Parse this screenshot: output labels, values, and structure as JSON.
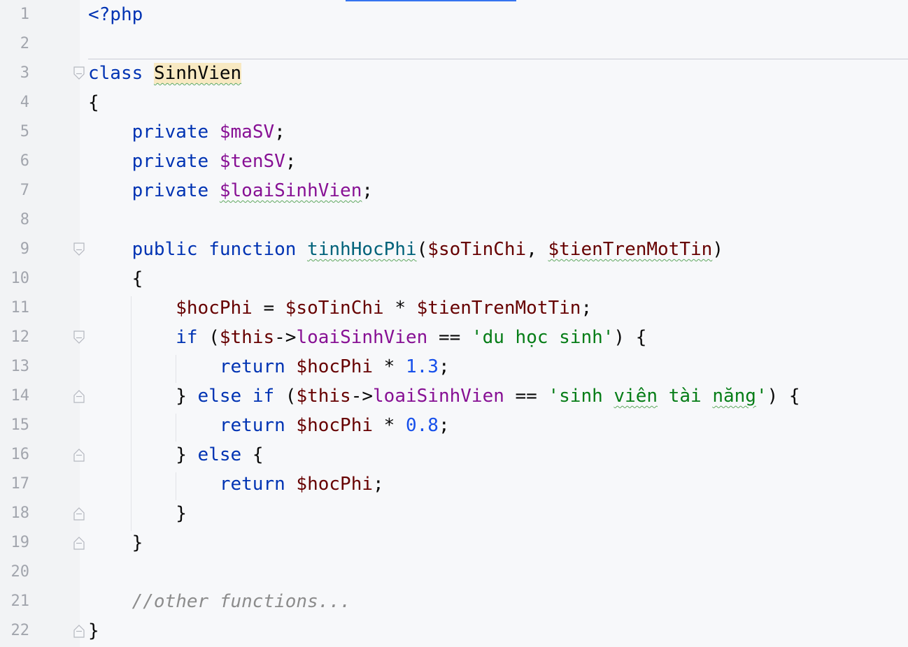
{
  "editor": {
    "language": "php",
    "lines": [
      {
        "num": "1",
        "tokens": [
          {
            "t": "<?php",
            "c": "kw"
          }
        ]
      },
      {
        "num": "2",
        "tokens": []
      },
      {
        "num": "3",
        "tokens": [
          {
            "t": "class",
            "c": "kw"
          },
          {
            "t": " ",
            "c": "punc"
          },
          {
            "t": "SinhVien",
            "c": "punc hl wavy"
          }
        ]
      },
      {
        "num": "4",
        "tokens": [
          {
            "t": "{",
            "c": "punc"
          }
        ]
      },
      {
        "num": "5",
        "tokens": [
          {
            "t": "    ",
            "c": "punc"
          },
          {
            "t": "private",
            "c": "kw"
          },
          {
            "t": " ",
            "c": "punc"
          },
          {
            "t": "$maSV",
            "c": "field"
          },
          {
            "t": ";",
            "c": "punc"
          }
        ]
      },
      {
        "num": "6",
        "tokens": [
          {
            "t": "    ",
            "c": "punc"
          },
          {
            "t": "private",
            "c": "kw"
          },
          {
            "t": " ",
            "c": "punc"
          },
          {
            "t": "$tenSV",
            "c": "field"
          },
          {
            "t": ";",
            "c": "punc"
          }
        ]
      },
      {
        "num": "7",
        "tokens": [
          {
            "t": "    ",
            "c": "punc"
          },
          {
            "t": "private",
            "c": "kw"
          },
          {
            "t": " ",
            "c": "punc"
          },
          {
            "t": "$loaiSinhVien",
            "c": "field wavy"
          },
          {
            "t": ";",
            "c": "punc"
          }
        ]
      },
      {
        "num": "8",
        "tokens": []
      },
      {
        "num": "9",
        "tokens": [
          {
            "t": "    ",
            "c": "punc"
          },
          {
            "t": "public",
            "c": "kw"
          },
          {
            "t": " ",
            "c": "punc"
          },
          {
            "t": "function",
            "c": "kw"
          },
          {
            "t": " ",
            "c": "punc"
          },
          {
            "t": "tinhHocPhi",
            "c": "fn wavy"
          },
          {
            "t": "(",
            "c": "punc"
          },
          {
            "t": "$soTinChi",
            "c": "var"
          },
          {
            "t": ", ",
            "c": "punc"
          },
          {
            "t": "$tienTrenMotTin",
            "c": "var wavy"
          },
          {
            "t": ")",
            "c": "punc"
          }
        ]
      },
      {
        "num": "10",
        "tokens": [
          {
            "t": "    {",
            "c": "punc"
          }
        ]
      },
      {
        "num": "11",
        "tokens": [
          {
            "t": "        ",
            "c": "punc"
          },
          {
            "t": "$hocPhi",
            "c": "var"
          },
          {
            "t": " = ",
            "c": "punc"
          },
          {
            "t": "$soTinChi",
            "c": "var"
          },
          {
            "t": " * ",
            "c": "punc"
          },
          {
            "t": "$tienTrenMotTin",
            "c": "var"
          },
          {
            "t": ";",
            "c": "punc"
          }
        ]
      },
      {
        "num": "12",
        "tokens": [
          {
            "t": "        ",
            "c": "punc"
          },
          {
            "t": "if",
            "c": "kw"
          },
          {
            "t": " (",
            "c": "punc"
          },
          {
            "t": "$this",
            "c": "var"
          },
          {
            "t": "->",
            "c": "punc"
          },
          {
            "t": "loaiSinhVien",
            "c": "field"
          },
          {
            "t": " == ",
            "c": "punc"
          },
          {
            "t": "'du học sinh'",
            "c": "str"
          },
          {
            "t": ") {",
            "c": "punc"
          }
        ]
      },
      {
        "num": "13",
        "tokens": [
          {
            "t": "            ",
            "c": "punc"
          },
          {
            "t": "return",
            "c": "kw"
          },
          {
            "t": " ",
            "c": "punc"
          },
          {
            "t": "$hocPhi",
            "c": "var"
          },
          {
            "t": " * ",
            "c": "punc"
          },
          {
            "t": "1.3",
            "c": "num"
          },
          {
            "t": ";",
            "c": "punc"
          }
        ]
      },
      {
        "num": "14",
        "tokens": [
          {
            "t": "        } ",
            "c": "punc"
          },
          {
            "t": "else if",
            "c": "kw"
          },
          {
            "t": " (",
            "c": "punc"
          },
          {
            "t": "$this",
            "c": "var"
          },
          {
            "t": "->",
            "c": "punc"
          },
          {
            "t": "loaiSinhVien",
            "c": "field"
          },
          {
            "t": " == ",
            "c": "punc"
          },
          {
            "t": "'sinh ",
            "c": "str"
          },
          {
            "t": "viên",
            "c": "str wavy"
          },
          {
            "t": " tài ",
            "c": "str"
          },
          {
            "t": "năng",
            "c": "str wavy"
          },
          {
            "t": "'",
            "c": "str"
          },
          {
            "t": ") {",
            "c": "punc"
          }
        ]
      },
      {
        "num": "15",
        "tokens": [
          {
            "t": "            ",
            "c": "punc"
          },
          {
            "t": "return",
            "c": "kw"
          },
          {
            "t": " ",
            "c": "punc"
          },
          {
            "t": "$hocPhi",
            "c": "var"
          },
          {
            "t": " * ",
            "c": "punc"
          },
          {
            "t": "0.8",
            "c": "num"
          },
          {
            "t": ";",
            "c": "punc"
          }
        ]
      },
      {
        "num": "16",
        "tokens": [
          {
            "t": "        } ",
            "c": "punc"
          },
          {
            "t": "else",
            "c": "kw"
          },
          {
            "t": " {",
            "c": "punc"
          }
        ]
      },
      {
        "num": "17",
        "tokens": [
          {
            "t": "            ",
            "c": "punc"
          },
          {
            "t": "return",
            "c": "kw"
          },
          {
            "t": " ",
            "c": "punc"
          },
          {
            "t": "$hocPhi",
            "c": "var"
          },
          {
            "t": ";",
            "c": "punc"
          }
        ]
      },
      {
        "num": "18",
        "tokens": [
          {
            "t": "        }",
            "c": "punc"
          }
        ]
      },
      {
        "num": "19",
        "tokens": [
          {
            "t": "    }",
            "c": "punc"
          }
        ]
      },
      {
        "num": "20",
        "tokens": []
      },
      {
        "num": "21",
        "tokens": [
          {
            "t": "    ",
            "c": "punc"
          },
          {
            "t": "//other functions...",
            "c": "cmt"
          }
        ]
      },
      {
        "num": "22",
        "tokens": [
          {
            "t": "}",
            "c": "punc"
          }
        ]
      }
    ],
    "fold_markers": [
      {
        "line": 3,
        "kind": "open"
      },
      {
        "line": 9,
        "kind": "open"
      },
      {
        "line": 12,
        "kind": "open"
      },
      {
        "line": 14,
        "kind": "close"
      },
      {
        "line": 16,
        "kind": "close"
      },
      {
        "line": 18,
        "kind": "close"
      },
      {
        "line": 19,
        "kind": "close"
      },
      {
        "line": 22,
        "kind": "close"
      }
    ],
    "colors": {
      "keyword": "#0033b3",
      "variable": "#660000",
      "field": "#871094",
      "function": "#00627a",
      "string": "#067d17",
      "number": "#1750eb",
      "comment": "#8c8c8c",
      "highlight": "#f8e9c2",
      "accent": "#3574f0"
    }
  }
}
